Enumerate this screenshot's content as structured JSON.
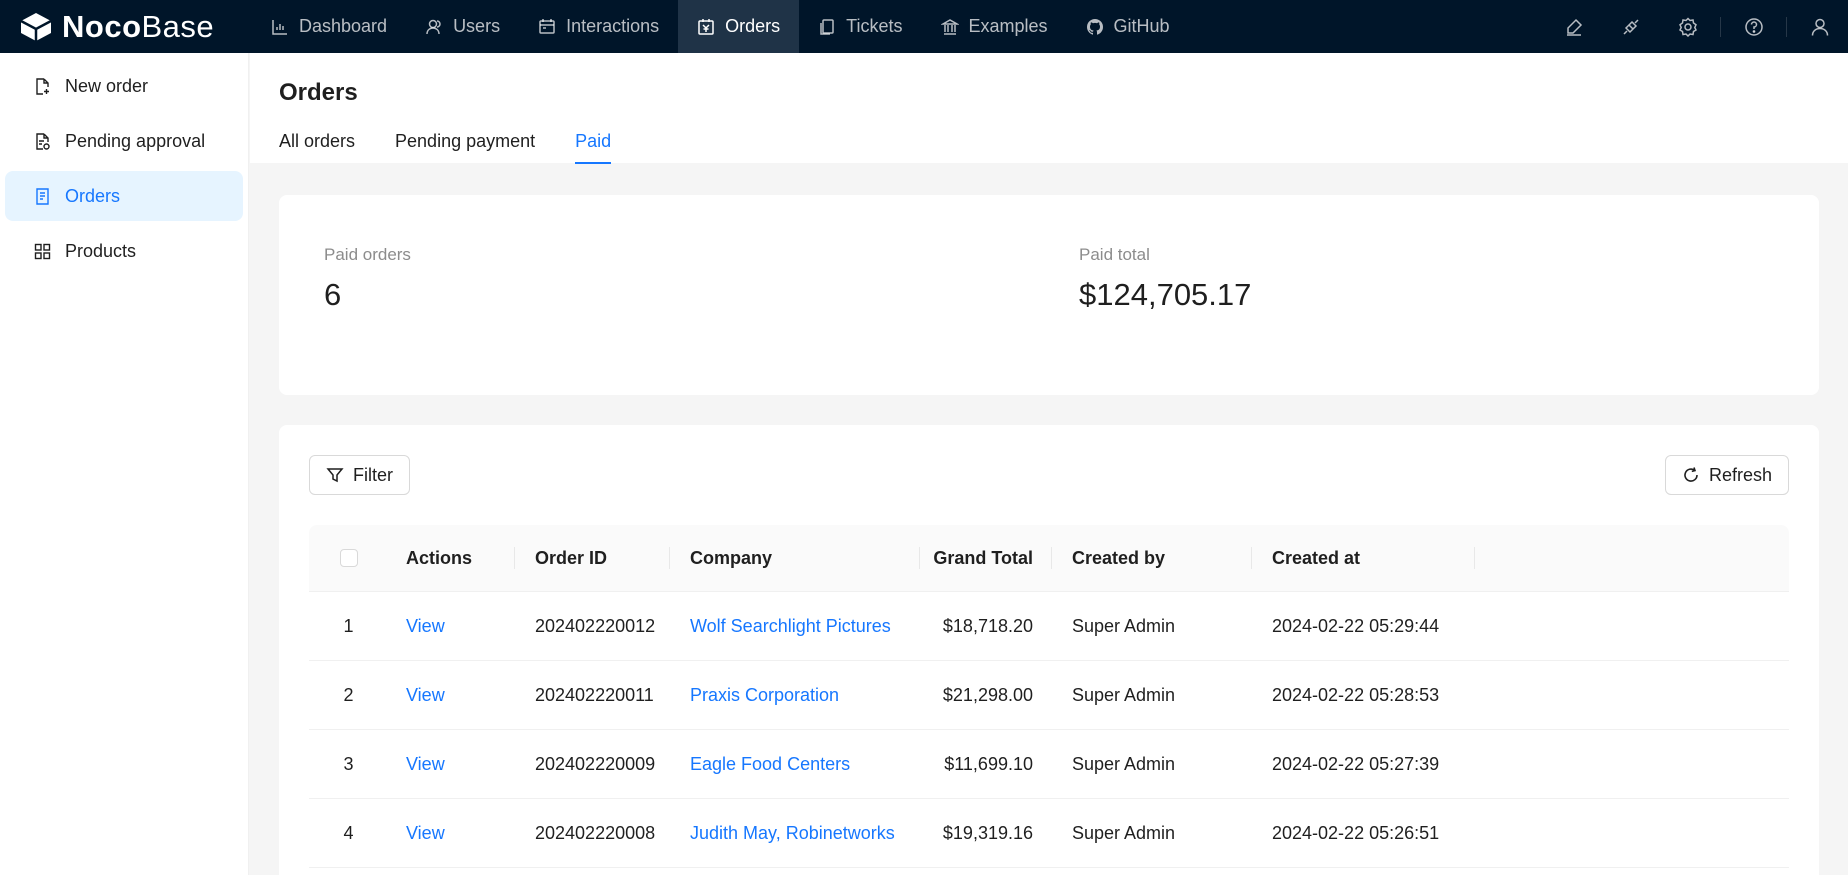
{
  "app": {
    "logo_bold": "Noco",
    "logo_light": "Base"
  },
  "nav": [
    {
      "label": "Dashboard",
      "icon": "bar-chart-icon"
    },
    {
      "label": "Users",
      "icon": "users-icon"
    },
    {
      "label": "Interactions",
      "icon": "calendar-icon"
    },
    {
      "label": "Orders",
      "icon": "account-book-icon",
      "active": true
    },
    {
      "label": "Tickets",
      "icon": "copy-icon"
    },
    {
      "label": "Examples",
      "icon": "bank-icon"
    },
    {
      "label": "GitHub",
      "icon": "github-icon"
    }
  ],
  "top_actions": [
    "highlight-icon",
    "plugin-icon",
    "settings-icon",
    "help-icon",
    "user-icon"
  ],
  "sidebar": {
    "items": [
      {
        "label": "New order",
        "icon": "file-add-icon"
      },
      {
        "label": "Pending approval",
        "icon": "file-sync-icon"
      },
      {
        "label": "Orders",
        "icon": "file-text-icon",
        "active": true
      },
      {
        "label": "Products",
        "icon": "appstore-icon"
      }
    ]
  },
  "page": {
    "title": "Orders",
    "tabs": [
      {
        "label": "All orders"
      },
      {
        "label": "Pending payment"
      },
      {
        "label": "Paid",
        "active": true
      }
    ]
  },
  "stats": {
    "paid_orders_label": "Paid orders",
    "paid_orders_value": "6",
    "paid_total_label": "Paid total",
    "paid_total_value": "$124,705.17"
  },
  "toolbar": {
    "filter_label": "Filter",
    "refresh_label": "Refresh"
  },
  "table": {
    "columns": {
      "actions": "Actions",
      "order_id": "Order ID",
      "company": "Company",
      "grand_total": "Grand Total",
      "created_by": "Created by",
      "created_at": "Created at"
    },
    "rows": [
      {
        "index": "1",
        "action": "View",
        "order_id": "202402220012",
        "company": "Wolf Searchlight Pictures",
        "grand_total": "$18,718.20",
        "created_by": "Super Admin",
        "created_at": "2024-02-22 05:29:44"
      },
      {
        "index": "2",
        "action": "View",
        "order_id": "202402220011",
        "company": "Praxis Corporation",
        "grand_total": "$21,298.00",
        "created_by": "Super Admin",
        "created_at": "2024-02-22 05:28:53"
      },
      {
        "index": "3",
        "action": "View",
        "order_id": "202402220009",
        "company": "Eagle Food Centers",
        "grand_total": "$11,699.10",
        "created_by": "Super Admin",
        "created_at": "2024-02-22 05:27:39"
      },
      {
        "index": "4",
        "action": "View",
        "order_id": "202402220008",
        "company": "Judith May, Robinetworks",
        "grand_total": "$19,319.16",
        "created_by": "Super Admin",
        "created_at": "2024-02-22 05:26:51"
      }
    ]
  },
  "colors": {
    "topbar_bg": "#001529",
    "accent": "#1677ff",
    "active_sidebar_bg": "#e6f4ff"
  }
}
